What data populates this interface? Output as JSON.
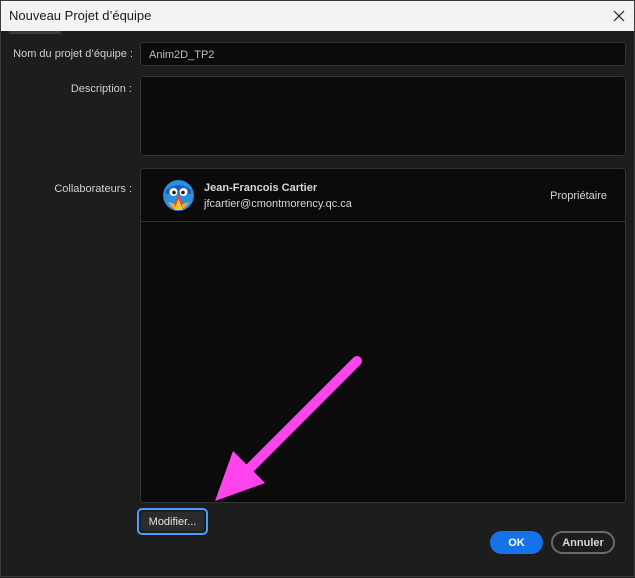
{
  "window": {
    "title": "Nouveau Projet d’équipe"
  },
  "form": {
    "project_name_label": "Nom du projet d’équipe :",
    "project_name_value": "Anim2D_TP2",
    "description_label": "Description :",
    "description_value": "",
    "collaborators_label": "Collaborateurs :"
  },
  "collaborators": [
    {
      "name": "Jean-Francois Cartier",
      "email": "jfcartier@cmontmorency.qc.ca",
      "role": "Propriétaire",
      "avatar_icon": "cartoon-face-avatar"
    }
  ],
  "buttons": {
    "modify_label": "Modifier...",
    "ok_label": "OK",
    "cancel_label": "Annuler"
  },
  "colors": {
    "accent": "#1473e6",
    "focus_ring": "#4a9bff",
    "annotation_arrow": "#ff44ee"
  },
  "annotation": {
    "type": "arrow",
    "points_to": "modify-button"
  }
}
